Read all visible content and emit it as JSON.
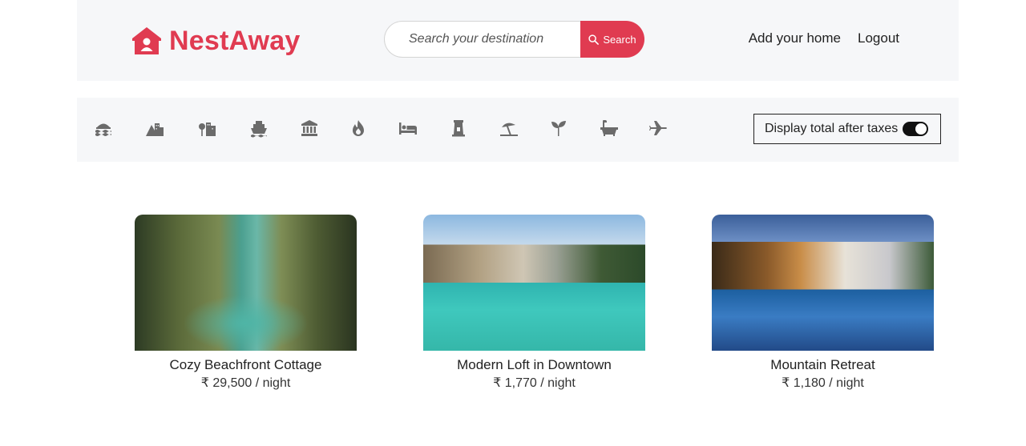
{
  "brand": {
    "name": "NestAway",
    "logo_icon": "house-icon",
    "color": "#e03b51"
  },
  "search": {
    "placeholder": "Search your destination",
    "button_label": "Search",
    "icon": "search-icon"
  },
  "nav": {
    "add_home": "Add your home",
    "logout": "Logout"
  },
  "filters": {
    "icons": [
      "waves-icon",
      "mountain-city-icon",
      "trees-buildings-icon",
      "ship-icon",
      "bank-icon",
      "fire-icon",
      "bed-icon",
      "tower-icon",
      "beach-umbrella-icon",
      "seedling-icon",
      "bathtub-icon",
      "plane-icon"
    ],
    "tax_toggle_label": "Display total after taxes",
    "tax_toggle_on": true
  },
  "listings": [
    {
      "title": "Cozy Beachfront Cottage",
      "price": "₹ 29,500 / night"
    },
    {
      "title": "Modern Loft in Downtown",
      "price": "₹ 1,770 / night"
    },
    {
      "title": "Mountain Retreat",
      "price": "₹ 1,180 / night"
    }
  ]
}
